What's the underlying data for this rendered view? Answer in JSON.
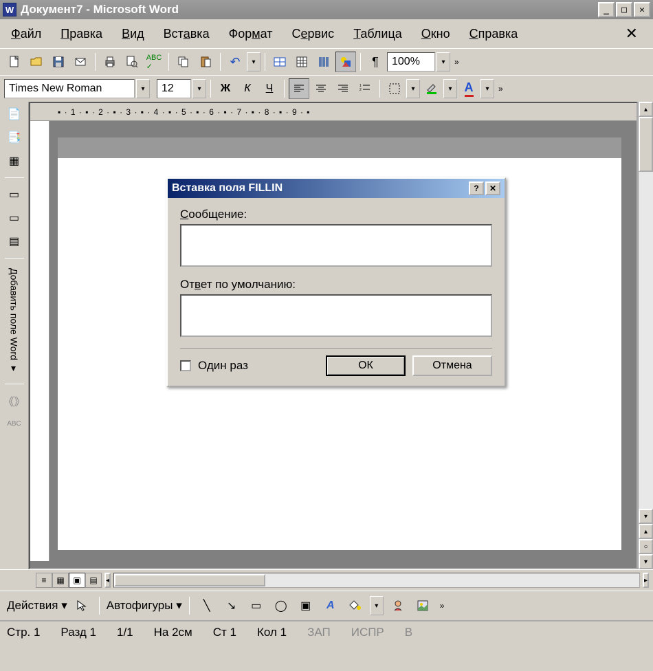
{
  "title": "Документ7 - Microsoft Word",
  "menubar": [
    "Файл",
    "Правка",
    "Вид",
    "Вставка",
    "Формат",
    "Сервис",
    "Таблица",
    "Окно",
    "Справка"
  ],
  "toolbar1": {
    "zoom": "100%"
  },
  "toolbar2": {
    "font_name": "Times New Roman",
    "font_size": "12",
    "bold": "Ж",
    "italic": "К",
    "underline": "Ч"
  },
  "sidebar_text": "Добавить поле Word ▾",
  "ruler_h": "▪ · 1 · ▪ · 2 · ▪ · 3 · ▪ · 4 · ▪ · 5 · ▪ · 6 · ▪ · 7 · ▪ · 8 · ▪ · 9 · ▪",
  "dialog": {
    "title": "Вставка поля FILLIN",
    "label_message": "Сообщение:",
    "label_default": "Ответ по умолчанию:",
    "checkbox": "Один раз",
    "ok": "ОК",
    "cancel": "Отмена"
  },
  "drawbar": {
    "actions": "Действия",
    "autoshapes": "Автофигуры"
  },
  "status": {
    "page": "Стр. 1",
    "section": "Разд 1",
    "pages": "1/1",
    "at": "На 2см",
    "line": "Ст 1",
    "col": "Кол 1",
    "rec": "ЗАП",
    "rev": "ИСПР",
    "ext": "В"
  }
}
